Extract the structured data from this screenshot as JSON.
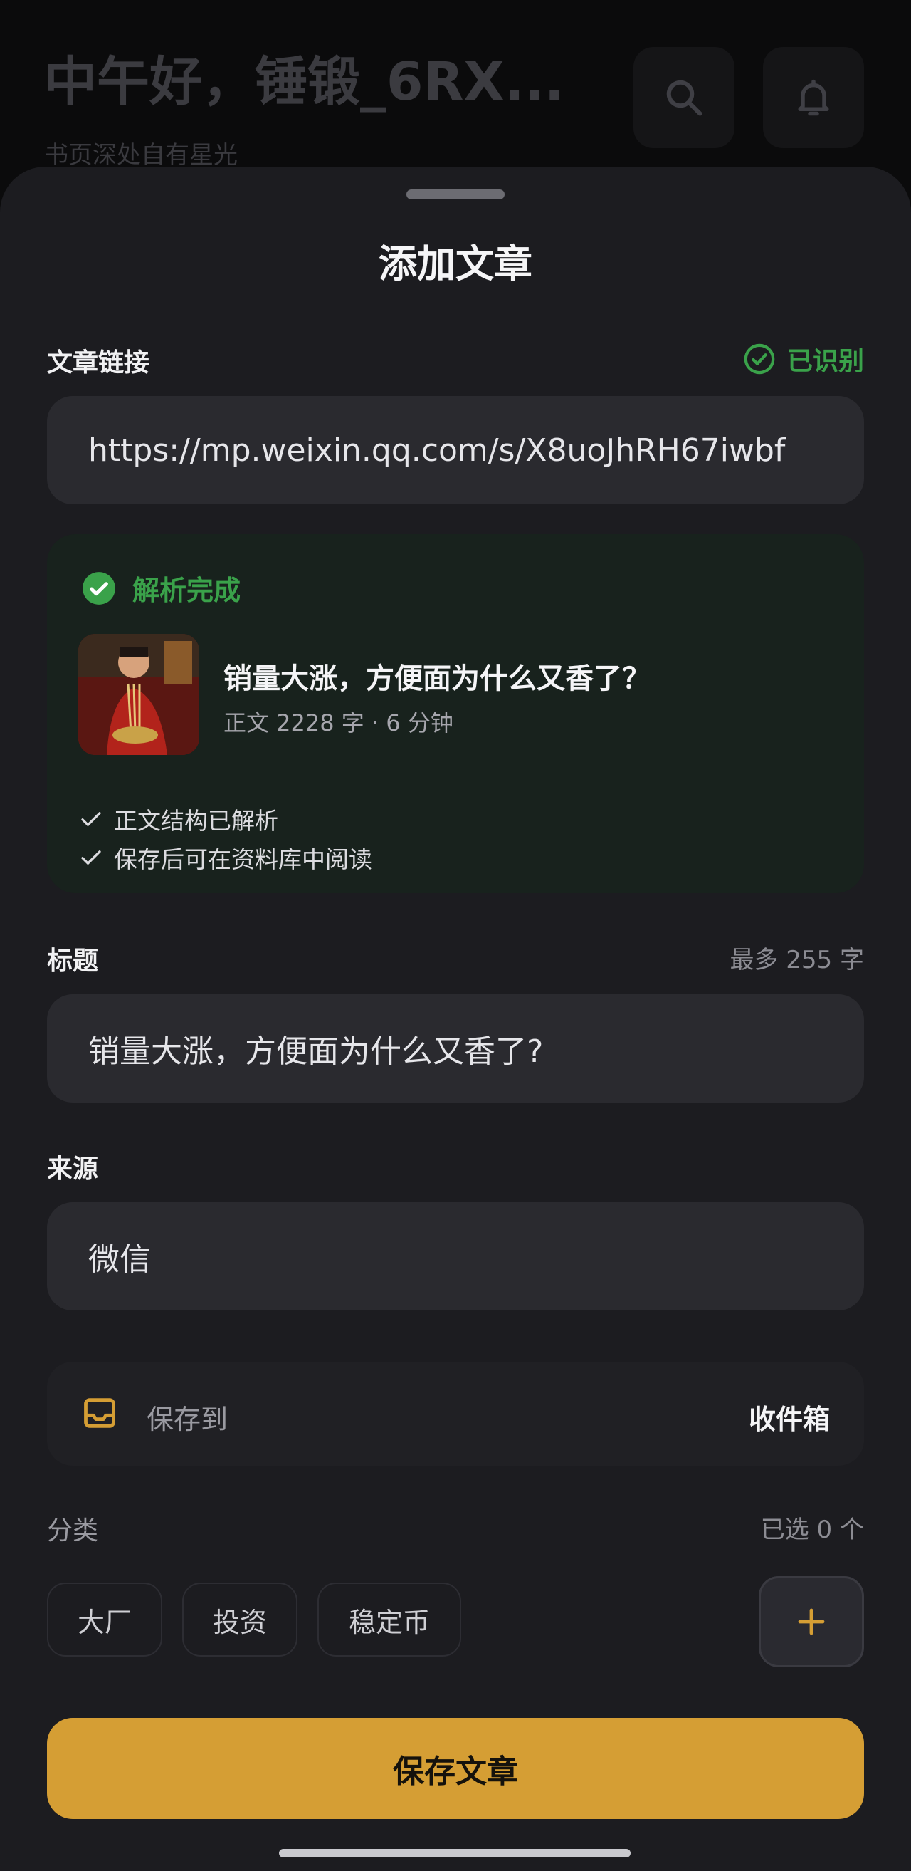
{
  "header": {
    "greeting": "中午好，锤锻_6RX...",
    "subtitle": "书页深处自有星光",
    "search_icon": "search-icon",
    "bell_icon": "bell-icon"
  },
  "sheet": {
    "title": "添加文章",
    "link": {
      "label": "文章链接",
      "status": "已识别",
      "value": "https://mp.weixin.qq.com/s/X8uoJhRH67iwbf"
    },
    "parse": {
      "status": "解析完成",
      "article_title": "销量大涨，方便面为什么又香了？",
      "meta": "正文 2228 字 · 6 分钟",
      "checks": [
        "正文结构已解析",
        "保存后可在资料库中阅读"
      ]
    },
    "title_field": {
      "label": "标题",
      "hint": "最多 255 字",
      "value": "销量大涨，方便面为什么又香了?"
    },
    "source_field": {
      "label": "来源",
      "value": "微信"
    },
    "save_to": {
      "label": "保存到",
      "value": "收件箱"
    },
    "category": {
      "label": "分类",
      "selected": "已选 0 个",
      "chips": [
        "大厂",
        "投资",
        "稳定币"
      ]
    },
    "save_button": "保存文章"
  },
  "colors": {
    "accent": "#d59e34",
    "success": "#3aa24a",
    "sheet_bg": "#1c1c20",
    "field_bg": "#2a2a2f"
  }
}
